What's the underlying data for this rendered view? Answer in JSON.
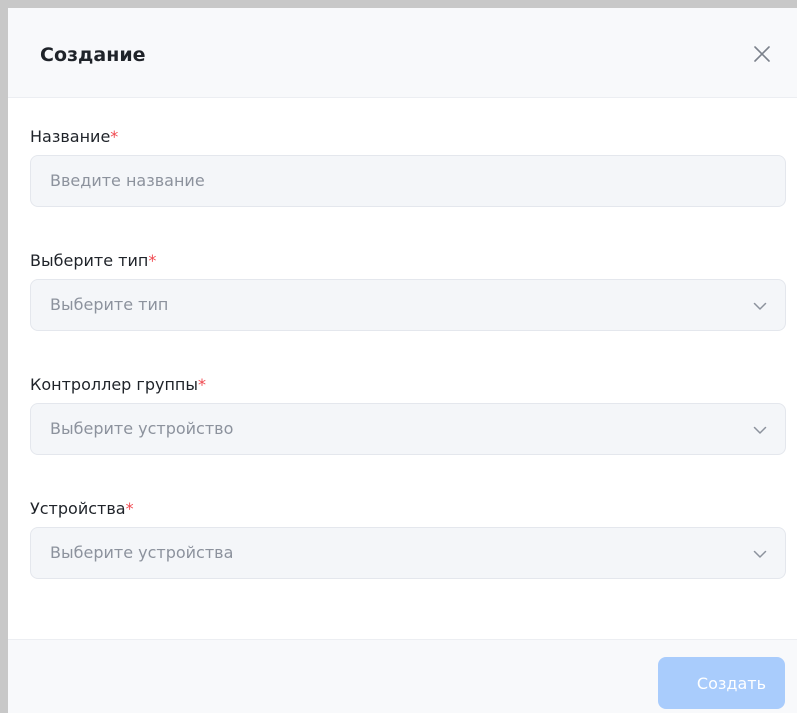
{
  "dialog": {
    "title": "Создание",
    "close_icon": "close-icon"
  },
  "form": {
    "fields": [
      {
        "label": "Название",
        "required_mark": "*",
        "type": "text-input",
        "value": "",
        "placeholder": "Введите название"
      },
      {
        "label": "Выберите тип",
        "required_mark": "*",
        "type": "select",
        "value": "",
        "placeholder": "Выберите тип",
        "icon": "chevron-down-icon"
      },
      {
        "label": "Контроллер группы",
        "required_mark": "*",
        "type": "select",
        "value": "",
        "placeholder": "Выберите устройство",
        "icon": "chevron-down-icon"
      },
      {
        "label": "Устройства",
        "required_mark": "*",
        "type": "multi-select",
        "value": "",
        "placeholder": "Выберите устройства",
        "icon": "chevron-down-icon"
      }
    ]
  },
  "footer": {
    "create_label": "Создать",
    "create_disabled": true
  },
  "colors": {
    "required": "#f0484f",
    "primary_disabled": "#a9ccfc",
    "input_background": "#f4f6f9",
    "placeholder": "#8c929d"
  }
}
